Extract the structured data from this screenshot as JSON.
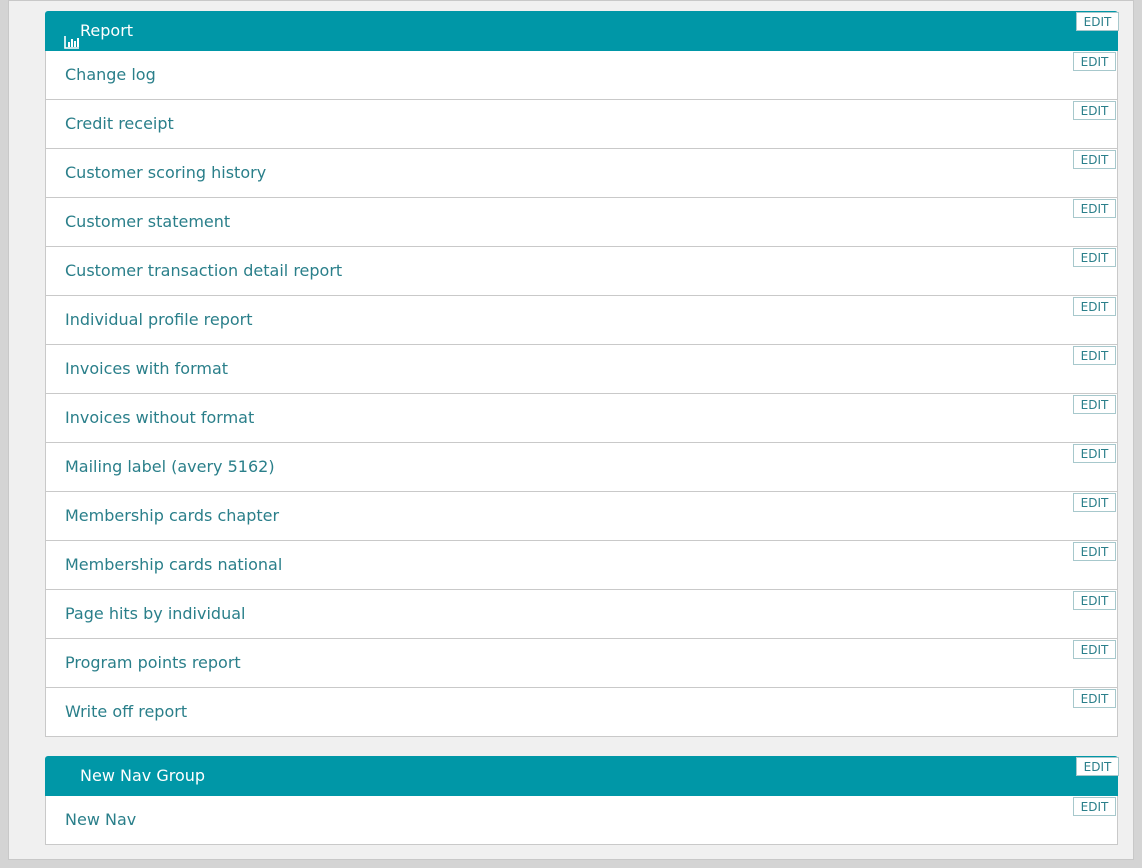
{
  "edit_label": "EDIT",
  "colors": {
    "header_bg": "#0097a7",
    "link": "#2a7f8a",
    "page_bg": "#f0f0f0"
  },
  "report_group": {
    "title": "Report",
    "icon": "bar-chart-icon",
    "items": [
      "Change log",
      "Credit receipt",
      "Customer scoring history",
      "Customer statement",
      "Customer transaction detail report",
      "Individual profile report",
      "Invoices with format",
      "Invoices without format",
      "Mailing label (avery 5162)",
      "Membership cards chapter",
      "Membership cards national",
      "Page hits by individual",
      "Program points report",
      "Write off report"
    ]
  },
  "nav_group": {
    "title": "New Nav Group",
    "items": [
      "New Nav"
    ]
  }
}
